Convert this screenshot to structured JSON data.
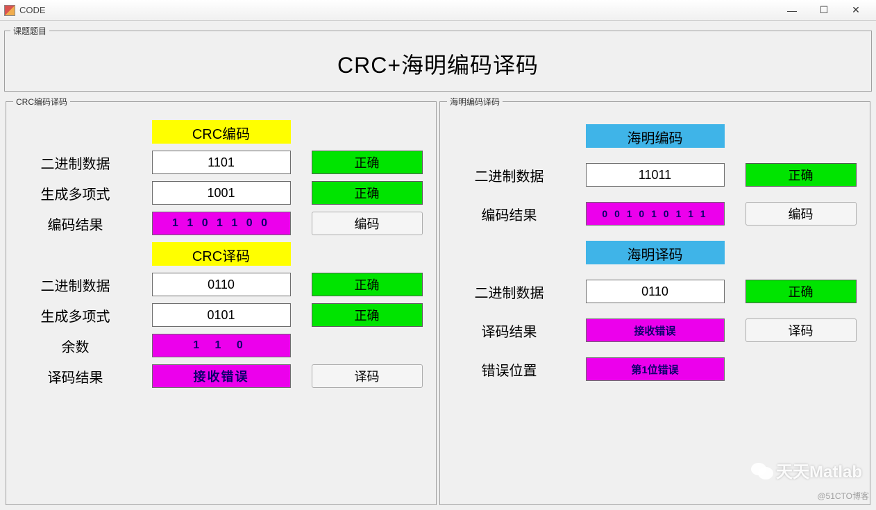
{
  "window": {
    "title": "CODE",
    "min": "—",
    "max": "☐",
    "close": "✕"
  },
  "topic": {
    "legend": "课题题目",
    "title": "CRC+海明编码译码"
  },
  "crc": {
    "legend": "CRC编码译码",
    "encode_header": "CRC编码",
    "binary_label": "二进制数据",
    "binary_value": "1101",
    "binary_ok": "正确",
    "poly_label": "生成多项式",
    "poly_value": "1001",
    "poly_ok": "正确",
    "result_label": "编码结果",
    "result_value": "1 1 0 1 1 0 0",
    "encode_btn": "编码",
    "decode_header": "CRC译码",
    "d_binary_label": "二进制数据",
    "d_binary_value": "0110",
    "d_binary_ok": "正确",
    "d_poly_label": "生成多项式",
    "d_poly_value": "0101",
    "d_poly_ok": "正确",
    "remainder_label": "余数",
    "remainder_value": "1 1 0",
    "d_result_label": "译码结果",
    "d_result_value": "接收错误",
    "decode_btn": "译码"
  },
  "hamming": {
    "legend": "海明编码译码",
    "encode_header": "海明编码",
    "binary_label": "二进制数据",
    "binary_value": "11011",
    "binary_ok": "正确",
    "result_label": "编码结果",
    "result_value": "0 0 1 0 1 0 1 1 1",
    "encode_btn": "编码",
    "decode_header": "海明译码",
    "d_binary_label": "二进制数据",
    "d_binary_value": "0110",
    "d_binary_ok": "正确",
    "d_result_label": "译码结果",
    "d_result_value": "接收错误",
    "decode_btn": "译码",
    "err_pos_label": "错误位置",
    "err_pos_value": "第1位错误"
  },
  "watermark": {
    "text": "天天Matlab",
    "blog": "@51CTO博客"
  }
}
